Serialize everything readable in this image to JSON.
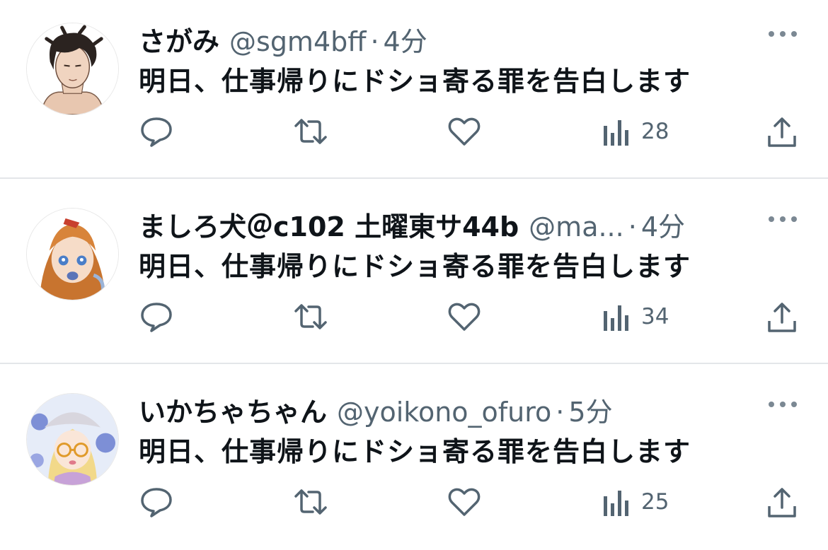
{
  "accent_color": "#536471",
  "tweets": [
    {
      "name": "さがみ",
      "handle": "@sgm4bff",
      "separator": "·",
      "time": "4分",
      "text": "明日、仕事帰りにドショ寄る罪を告白します",
      "views": "28",
      "avatar": "dark-haired-man-avatar"
    },
    {
      "name": "ましろ犬＠c102 土曜東サ44b",
      "handle": "@ma...",
      "separator": "·",
      "time": "4分",
      "text": "明日、仕事帰りにドショ寄る罪を告白します",
      "views": "34",
      "avatar": "orange-haired-girl-avatar"
    },
    {
      "name": "いかちゃちゃん",
      "handle": "@yoikono_ofuro",
      "separator": "·",
      "time": "5分",
      "text": "明日、仕事帰りにドショ寄る罪を告白します",
      "views": "25",
      "avatar": "blonde-girl-with-glasses-avatar"
    }
  ],
  "icons": [
    "reply-icon",
    "retweet-icon",
    "like-icon",
    "views-icon",
    "share-icon",
    "more-icon"
  ]
}
